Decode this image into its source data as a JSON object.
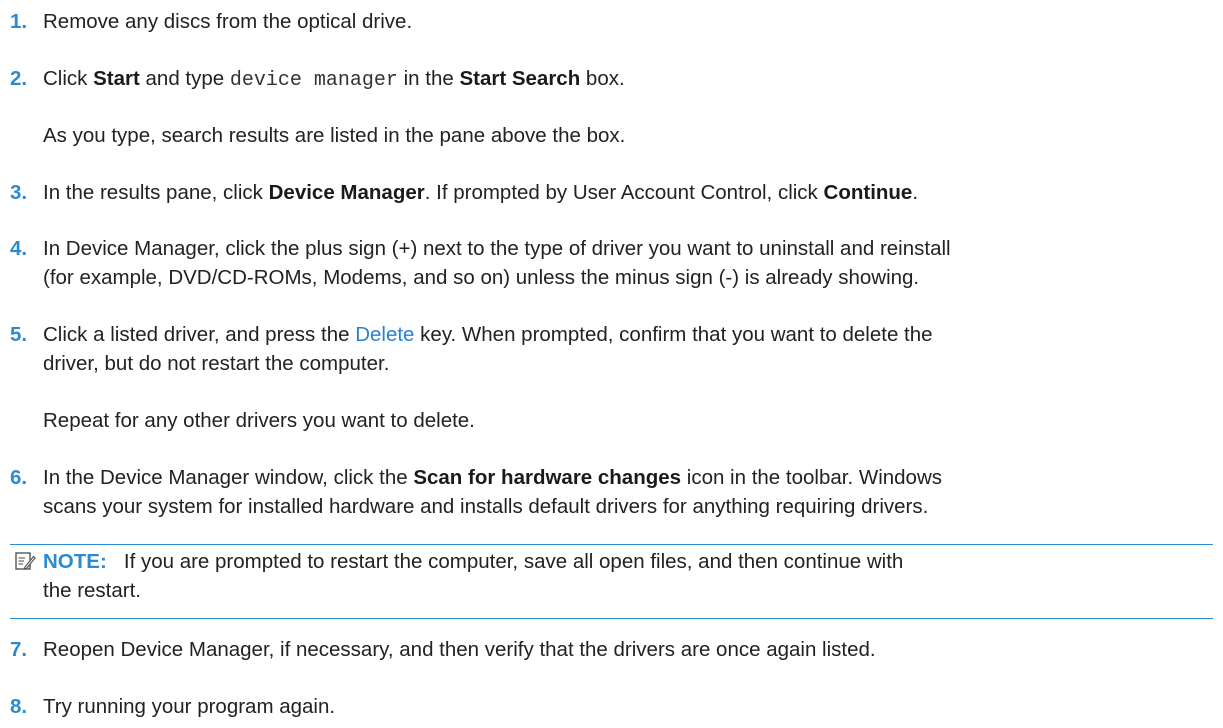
{
  "steps": [
    {
      "num": "1.",
      "text": "Remove any discs from the optical drive."
    },
    {
      "num": "2.",
      "t1": "Click ",
      "b1": "Start",
      "t2": " and type ",
      "code": "device manager",
      "t3": " in the ",
      "b2": "Start Search",
      "t4": " box."
    },
    {
      "sub2": "As you type, search results are listed in the pane above the box."
    },
    {
      "num": "3.",
      "t1": "In the results pane, click ",
      "b1": "Device Manager",
      "t2": ". If prompted by User Account Control, click ",
      "b2": "Continue",
      "t3": "."
    },
    {
      "num": "4.",
      "l1": "In Device Manager, click the plus sign (+) next to the type of driver you want to uninstall and reinstall",
      "l2": "(for example, DVD/CD-ROMs, Modems, and so on) unless the minus sign (-) is already showing."
    },
    {
      "num": "5.",
      "t1": "Click a listed driver, and press the ",
      "key": "Delete",
      "t2": " key. When prompted, confirm that you want to delete the",
      "l2": "driver, but do not restart the computer.",
      "sub": "Repeat for any other drivers you want to delete."
    },
    {
      "num": "6.",
      "t1": "In the Device Manager window, click the ",
      "b1": "Scan for hardware changes",
      "t2": " icon in the toolbar. Windows",
      "l2": "scans your system for installed hardware and installs default drivers for anything requiring drivers."
    },
    {
      "num": "7.",
      "text": "Reopen Device Manager, if necessary, and then verify that the drivers are once again listed."
    },
    {
      "num": "8.",
      "text": "Try running your program again."
    }
  ],
  "note": {
    "label": "NOTE:",
    "l1": "If you are prompted to restart the computer, save all open files, and then continue with",
    "l2": "the restart."
  },
  "colors": {
    "accent": "#2b8ad2",
    "text": "#222222"
  }
}
